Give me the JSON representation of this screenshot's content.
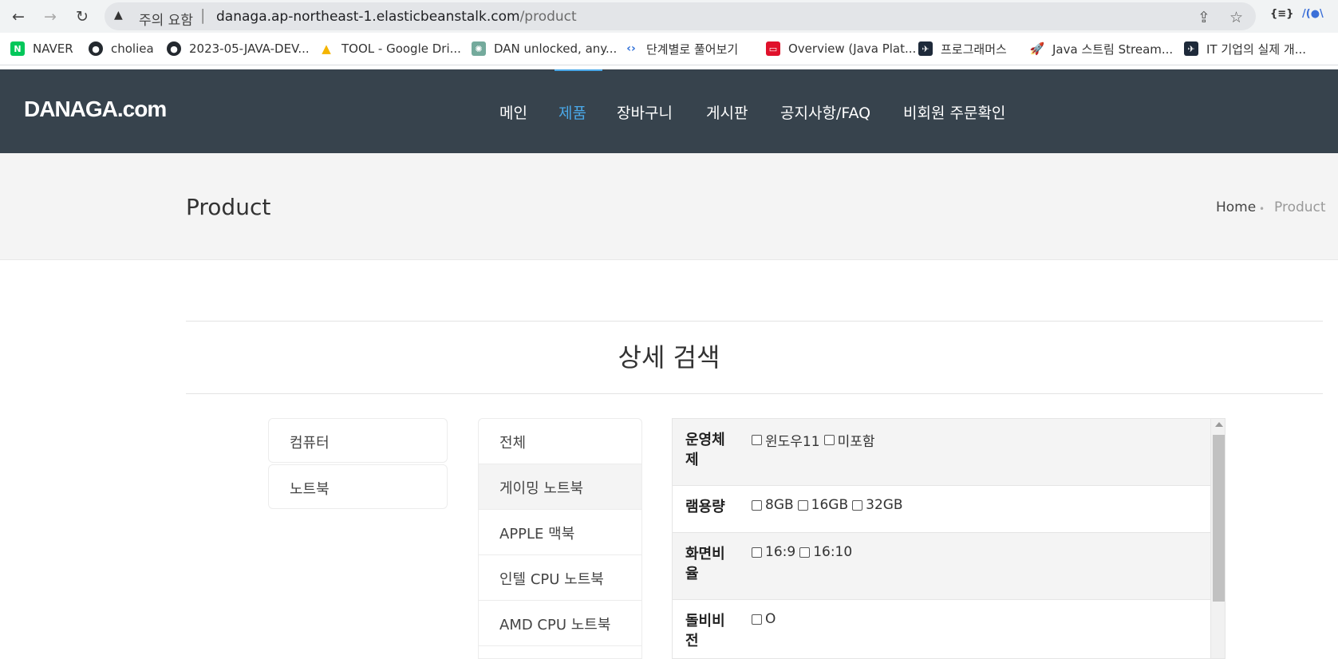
{
  "browser": {
    "back_icon": "←",
    "forward_icon": "→",
    "reload_icon": "↻",
    "warning_icon": "▲",
    "security_label": "주의 요함",
    "separator": "|",
    "url_host": "danaga.ap-northeast-1.elasticbeanstalk.com",
    "url_path": "/product",
    "share_icon": "⇪",
    "star_icon": "☆",
    "ext1": "{≡}",
    "ext2": "/(●\\"
  },
  "bookmarks": [
    {
      "label": "NAVER",
      "icon": "N",
      "color": "#03c75a"
    },
    {
      "label": "choliea",
      "icon": "●",
      "color": "#24292f"
    },
    {
      "label": "2023-05-JAVA-DEV...",
      "icon": "●",
      "color": "#24292f"
    },
    {
      "label": "TOOL - Google Dri...",
      "icon": "▲",
      "color": "#f4b400"
    },
    {
      "label": "DAN unlocked, any...",
      "icon": "✺",
      "color": "#74aa9c"
    },
    {
      "label": "단계별로 풀어보기",
      "icon": "‹›",
      "color": "#2e6fd8"
    },
    {
      "label": "Overview (Java Plat...",
      "icon": "▭",
      "color": "#e0112b"
    },
    {
      "label": "프로그래머스",
      "icon": "✈",
      "color": "#1e2a3a"
    },
    {
      "label": "Java 스트림 Stream...",
      "icon": "🚀",
      "color": "#ffffff"
    },
    {
      "label": "IT 기업의 실제 개...",
      "icon": "✈",
      "color": "#1e2a3a"
    }
  ],
  "site": {
    "logo": "DANAGA.com",
    "menu": [
      "메인",
      "제품",
      "장바구니",
      "게시판",
      "공지사항/FAQ",
      "비회원 주문확인"
    ],
    "active_menu": "제품",
    "page_title": "Product",
    "breadcrumb": {
      "home": "Home",
      "dot": "•",
      "current": "Product"
    }
  },
  "search": {
    "title": "상세 검색",
    "categories": [
      "컴퓨터",
      "노트북"
    ],
    "subcategories": [
      "전체",
      "게이밍 노트북",
      "APPLE 맥북",
      "인텔 CPU 노트북",
      "AMD CPU 노트북"
    ],
    "selected_subcategory": "게이밍 노트북",
    "filters": [
      {
        "label": "운영체제",
        "options": [
          "윈도우11",
          "미포함"
        ]
      },
      {
        "label": "램용량",
        "options": [
          "8GB",
          "16GB",
          "32GB"
        ]
      },
      {
        "label": "화면비율",
        "options": [
          "16:9",
          "16:10"
        ]
      },
      {
        "label": "돌비비전",
        "options": [
          "O"
        ]
      }
    ]
  },
  "colors": {
    "header_bg": "#37434d",
    "accent": "#4aa8e8",
    "band_bg": "#f4f4f4"
  }
}
